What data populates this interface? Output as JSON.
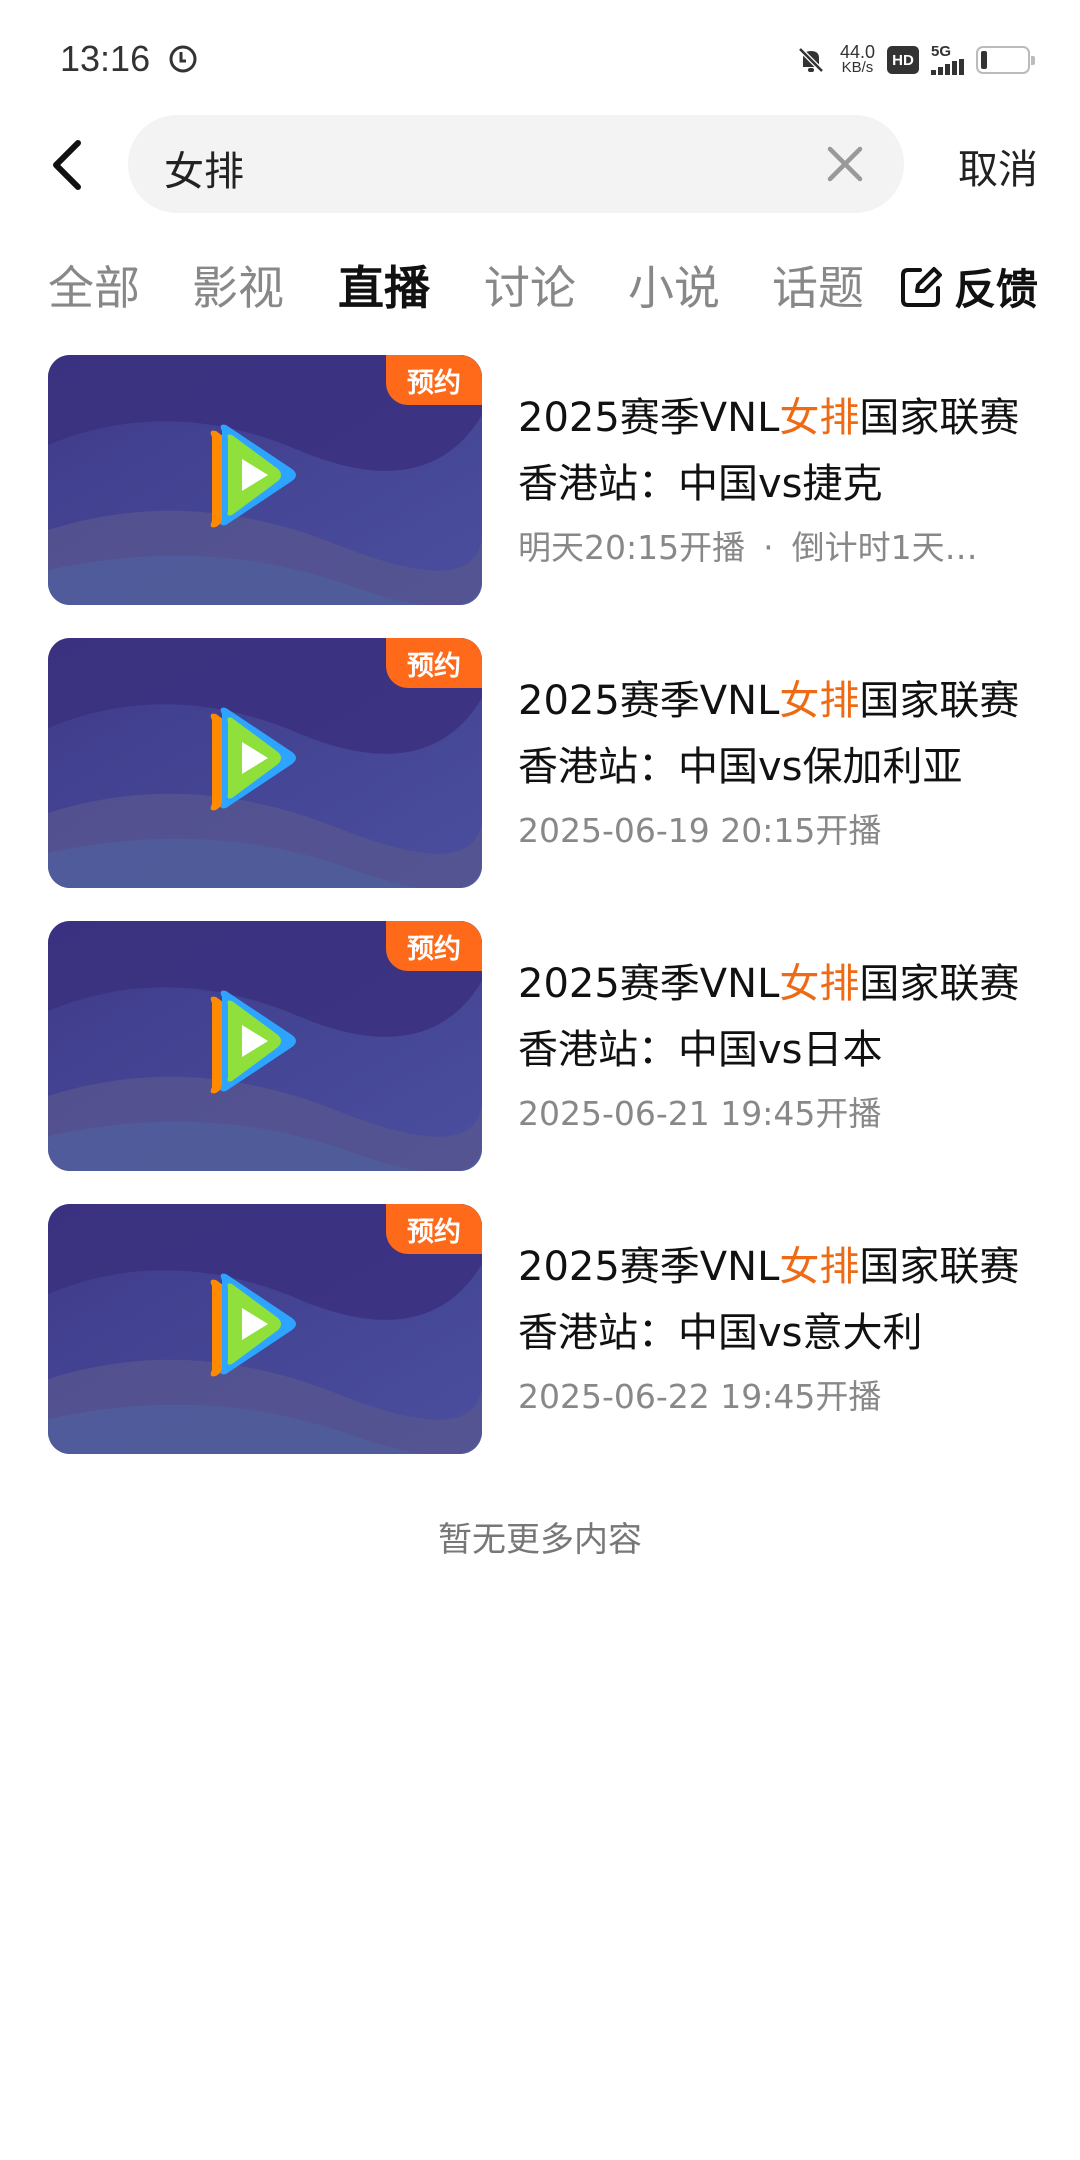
{
  "status_bar": {
    "time": "13:16",
    "net_speed_value": "44.0",
    "net_speed_unit": "KB/s",
    "hd_label": "HD",
    "network_type": "5G"
  },
  "search": {
    "query": "女排",
    "cancel_label": "取消"
  },
  "tabs": [
    {
      "label": "全部",
      "active": false
    },
    {
      "label": "影视",
      "active": false
    },
    {
      "label": "直播",
      "active": true
    },
    {
      "label": "讨论",
      "active": false
    },
    {
      "label": "小说",
      "active": false
    },
    {
      "label": "话题",
      "active": false
    }
  ],
  "feedback_label": "反馈",
  "results": [
    {
      "badge": "预约",
      "title_prefix": "2025赛季VNL",
      "title_highlight": "女排",
      "title_suffix": "国家联赛香港站：中国vs捷克",
      "meta": "明天20:15开播",
      "meta_dot": "·",
      "meta_extra": "倒计时1天…"
    },
    {
      "badge": "预约",
      "title_prefix": "2025赛季VNL",
      "title_highlight": "女排",
      "title_suffix": "国家联赛香港站：中国vs保加利亚",
      "meta": "2025-06-19 20:15开播"
    },
    {
      "badge": "预约",
      "title_prefix": "2025赛季VNL",
      "title_highlight": "女排",
      "title_suffix": "国家联赛香港站：中国vs日本",
      "meta": "2025-06-21 19:45开播"
    },
    {
      "badge": "预约",
      "title_prefix": "2025赛季VNL",
      "title_highlight": "女排",
      "title_suffix": "国家联赛香港站：中国vs意大利",
      "meta": "2025-06-22 19:45开播"
    }
  ],
  "no_more_text": "暂无更多内容",
  "colors": {
    "highlight": "#ee6a14",
    "badge": "#ff6a1a",
    "thumb_bg": "#4a3a8c"
  }
}
